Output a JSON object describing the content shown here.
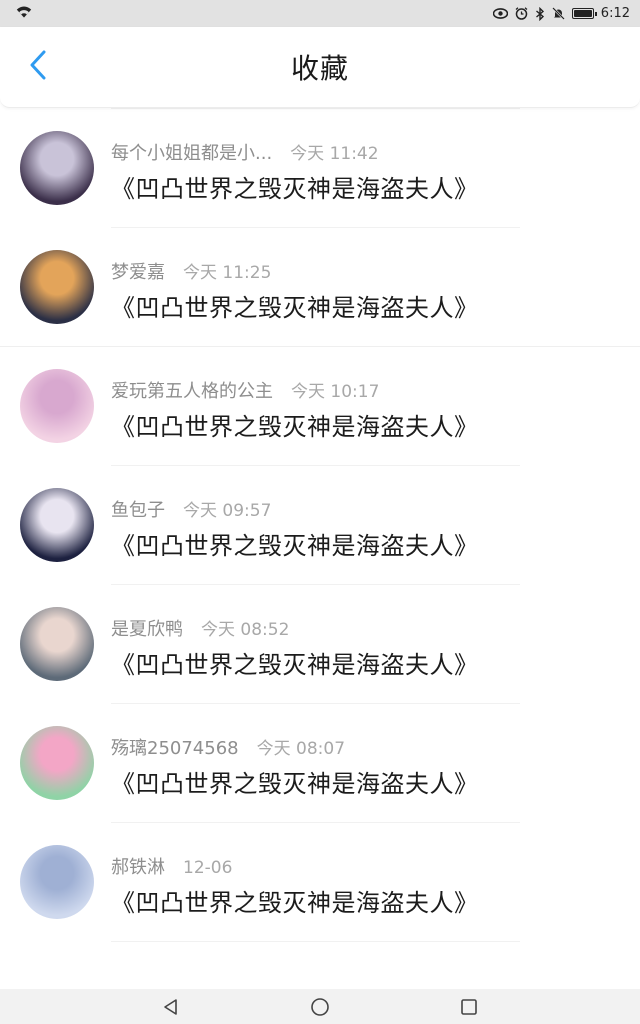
{
  "status_bar": {
    "time": "6:12"
  },
  "header": {
    "title": "收藏",
    "back_icon": "chevron-left-icon",
    "accent": "#2f9bf0"
  },
  "favorites": [
    {
      "author": "",
      "time": "",
      "title": "《凹凸世界之毁灭神是海盗夫人》",
      "avatar_colors": [
        "#c6a6ee",
        "#b08ae0"
      ]
    },
    {
      "author": "每个小姐姐都是小...",
      "time": "今天 11:42",
      "title": "《凹凸世界之毁灭神是海盗夫人》",
      "avatar_colors": [
        "#3b2f4a",
        "#c9c3d8"
      ]
    },
    {
      "author": "梦爱嘉",
      "time": "今天 11:25",
      "title": "《凹凸世界之毁灭神是海盗夫人》",
      "avatar_colors": [
        "#2b2f45",
        "#e3a45a"
      ]
    },
    {
      "author": "爱玩第五人格的公主",
      "time": "今天 10:17",
      "title": "《凹凸世界之毁灭神是海盗夫人》",
      "avatar_colors": [
        "#f3d3e4",
        "#d8a8cf"
      ]
    },
    {
      "author": "鱼包子",
      "time": "今天 09:57",
      "title": "《凹凸世界之毁灭神是海盗夫人》",
      "avatar_colors": [
        "#1d2140",
        "#e8e4f0"
      ]
    },
    {
      "author": "是夏欣鸭",
      "time": "今天 08:52",
      "title": "《凹凸世界之毁灭神是海盗夫人》",
      "avatar_colors": [
        "#5d6a78",
        "#e9d6cf"
      ]
    },
    {
      "author": "殇璃25074568",
      "time": "今天 08:07",
      "title": "《凹凸世界之毁灭神是海盗夫人》",
      "avatar_colors": [
        "#8fd3a6",
        "#f3a6c6"
      ]
    },
    {
      "author": "郝铁淋",
      "time": "12-06",
      "title": "《凹凸世界之毁灭神是海盗夫人》",
      "avatar_colors": [
        "#cfd9ee",
        "#9fb0d4"
      ]
    }
  ],
  "nav_bar": {
    "back_icon": "triangle-back-icon",
    "home_icon": "circle-home-icon",
    "recents_icon": "square-recents-icon"
  }
}
